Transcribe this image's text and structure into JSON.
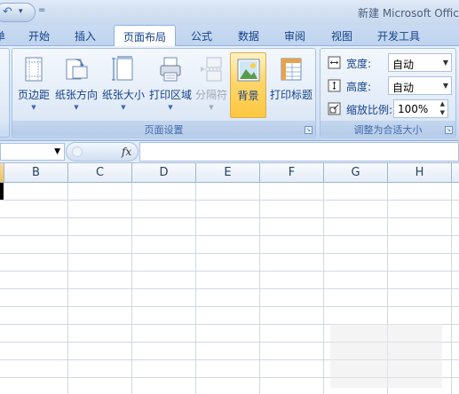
{
  "title": {
    "text": "新建 Microsoft Offic"
  },
  "qat": {
    "more": "="
  },
  "tabs": [
    {
      "label": "单"
    },
    {
      "label": "开始"
    },
    {
      "label": "插入"
    },
    {
      "label": "页面布局"
    },
    {
      "label": "公式"
    },
    {
      "label": "数据"
    },
    {
      "label": "审阅"
    },
    {
      "label": "视图"
    },
    {
      "label": "开发工具"
    }
  ],
  "ribbon": {
    "page_setup": {
      "title": "页面设置",
      "buttons": [
        {
          "label": "页边距",
          "icon": "margins-icon"
        },
        {
          "label": "纸张方向",
          "icon": "orientation-icon"
        },
        {
          "label": "纸张大小",
          "icon": "paper-size-icon"
        },
        {
          "label": "打印区域",
          "icon": "print-area-icon"
        },
        {
          "label": "分隔符",
          "icon": "breaks-icon"
        },
        {
          "label": "背景",
          "icon": "background-icon"
        },
        {
          "label": "打印标题",
          "icon": "print-titles-icon"
        }
      ]
    },
    "scale_to_fit": {
      "title": "调整为合适大小",
      "width_label": "宽度:",
      "width_value": "自动",
      "height_label": "高度:",
      "height_value": "自动",
      "scale_label": "缩放比例:",
      "scale_value": "100%"
    }
  },
  "formula_bar": {
    "fx": "fx"
  },
  "columns": [
    "B",
    "C",
    "D",
    "E",
    "F",
    "G",
    "H"
  ],
  "colors": {
    "ribbon_text": "#15428b",
    "active_button": "#ffd66b",
    "grid_line": "#d0d7e5"
  }
}
